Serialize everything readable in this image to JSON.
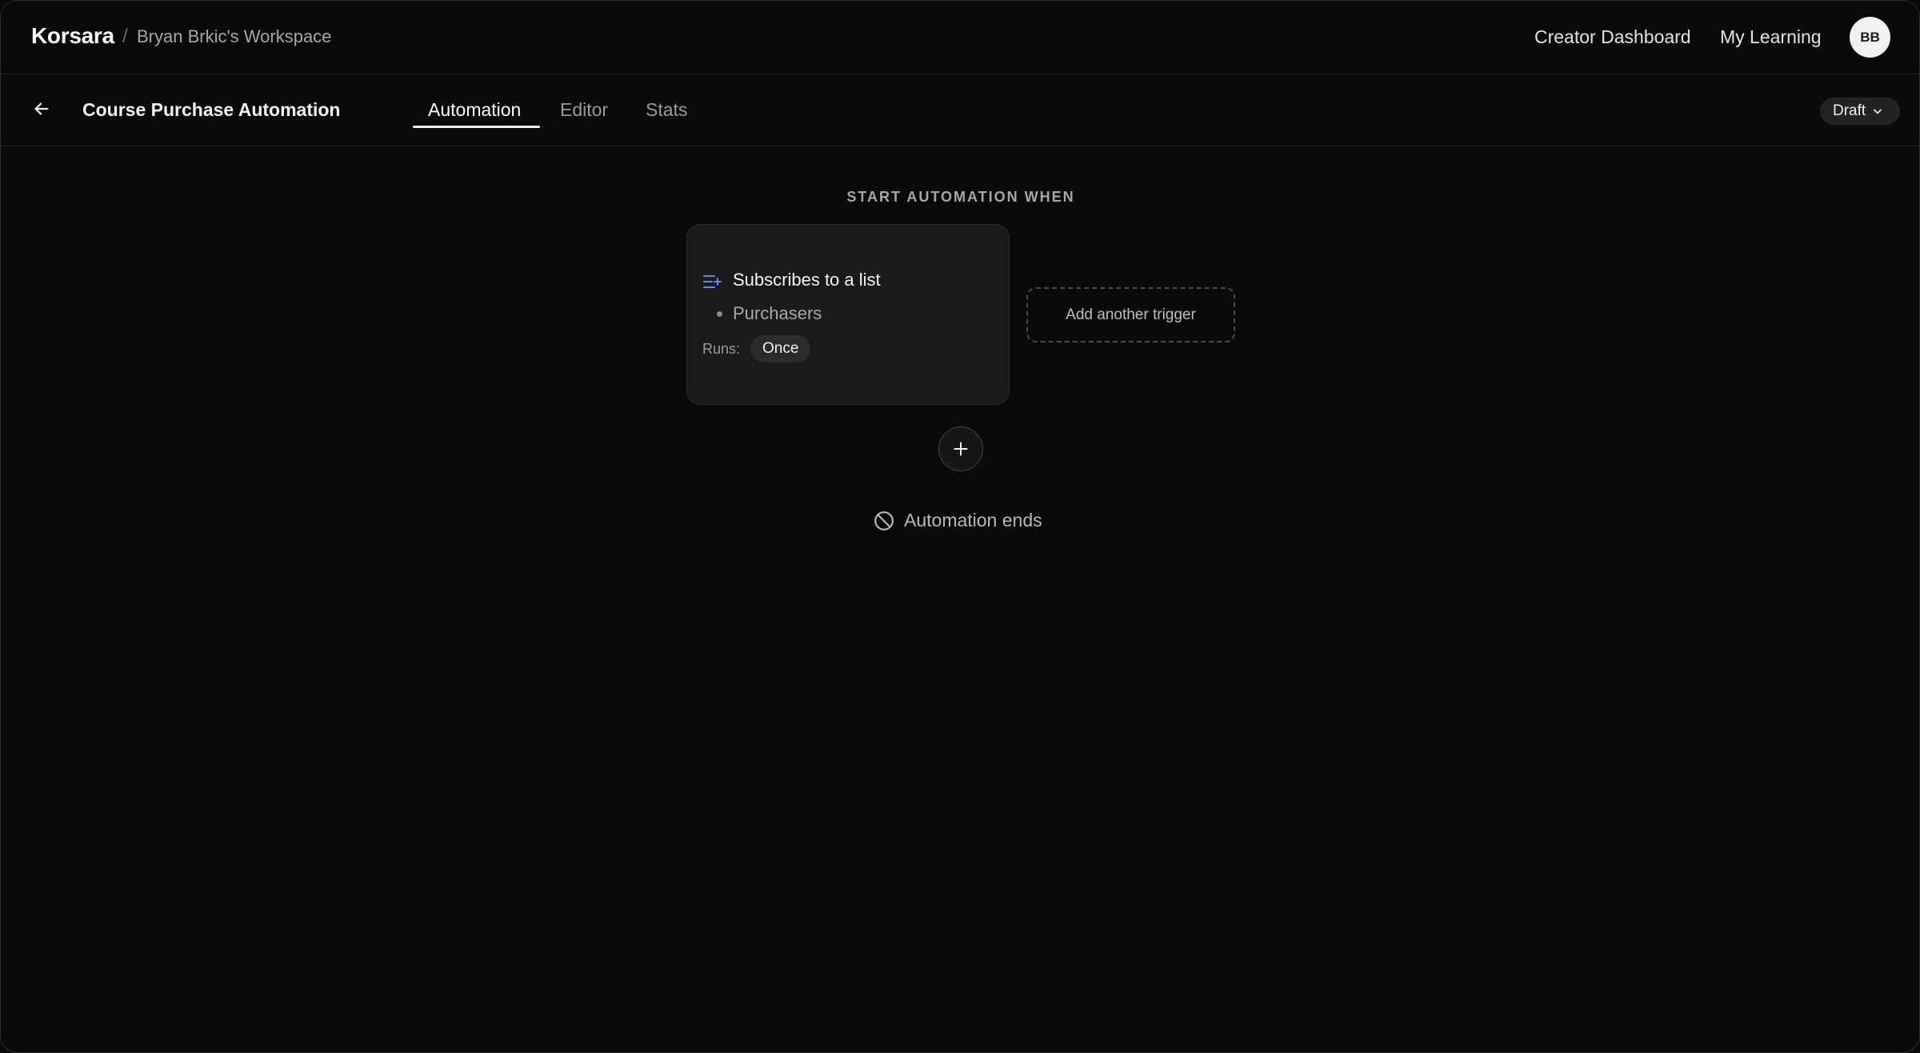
{
  "header": {
    "brand": "Korsara",
    "separator": "/",
    "workspace": "Bryan Brkic's Workspace",
    "nav": {
      "creator_dashboard": "Creator Dashboard",
      "my_learning": "My Learning"
    },
    "avatar_initials": "BB"
  },
  "subheader": {
    "title": "Course Purchase Automation",
    "tabs": [
      {
        "label": "Automation",
        "active": true
      },
      {
        "label": "Editor",
        "active": false
      },
      {
        "label": "Stats",
        "active": false
      }
    ],
    "status": "Draft"
  },
  "canvas": {
    "section_label": "START AUTOMATION WHEN",
    "trigger": {
      "icon": "list-add-icon",
      "title": "Subscribes to a list",
      "list_name": "Purchasers",
      "runs_label": "Runs:",
      "runs_value": "Once"
    },
    "add_trigger_label": "Add another trigger",
    "end_label": "Automation ends"
  },
  "colors": {
    "background": "#0a0a0a",
    "card": "#1a1a1a",
    "accent_icon": "#5b8def",
    "text_primary": "#f2f2f2",
    "text_muted": "#a6a6a6"
  }
}
